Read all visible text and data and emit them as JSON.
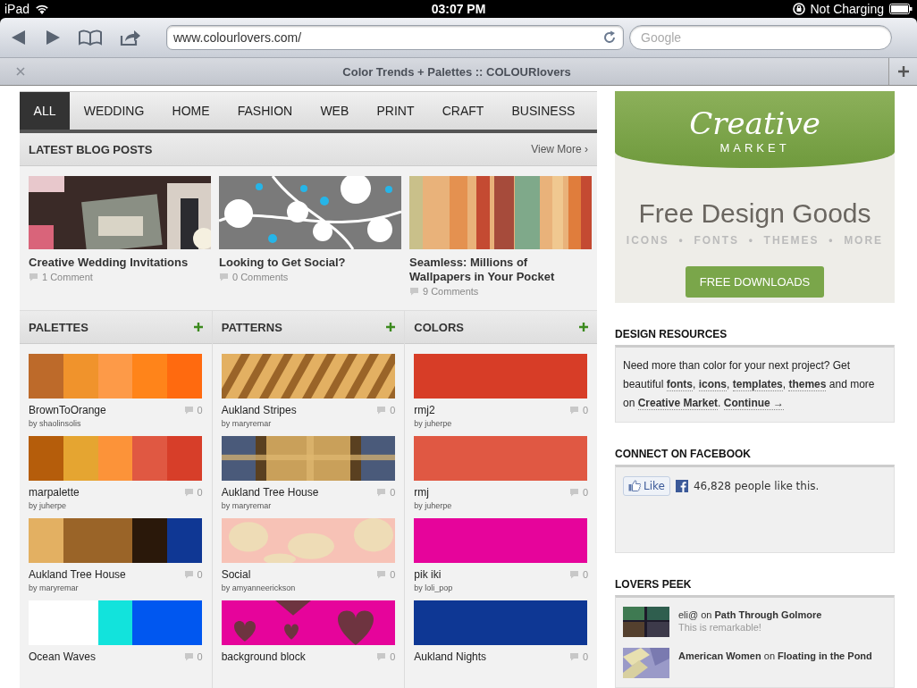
{
  "status_bar": {
    "device": "iPad",
    "time": "03:07 PM",
    "charging": "Not Charging"
  },
  "browser": {
    "url": "www.colourlovers.com/",
    "search_placeholder": "Google",
    "tab_title": "Color Trends + Palettes :: COLOURlovers"
  },
  "nav": [
    {
      "label": "ALL",
      "selected": true
    },
    {
      "label": "WEDDING",
      "selected": false
    },
    {
      "label": "HOME",
      "selected": false
    },
    {
      "label": "FASHION",
      "selected": false
    },
    {
      "label": "WEB",
      "selected": false
    },
    {
      "label": "PRINT",
      "selected": false
    },
    {
      "label": "CRAFT",
      "selected": false
    },
    {
      "label": "BUSINESS",
      "selected": false
    }
  ],
  "blog": {
    "title": "LATEST BLOG POSTS",
    "more": "View More ›",
    "posts": [
      {
        "title": "Creative Wedding Invitations",
        "comments": "1 Comment"
      },
      {
        "title": "Looking to Get Social?",
        "comments": "0 Comments"
      },
      {
        "title": "Seamless: Millions of Wallpapers in Your Pocket",
        "comments": "9 Comments"
      }
    ]
  },
  "sections": [
    {
      "title": "PALETTES",
      "kind": "palettes",
      "items": [
        {
          "name": "BrownToOrange",
          "author": "by shaolinsolis",
          "count": "0",
          "swatches": [
            {
              "color": "#bd6a2a"
            },
            {
              "color": "#f0932c"
            },
            {
              "color": "#fd9a48"
            },
            {
              "color": "#ff841a"
            },
            {
              "color": "#ff6a0f"
            }
          ]
        },
        {
          "name": "marpalette",
          "author": "by juherpe",
          "count": "0",
          "swatches": [
            {
              "color": "#b55d0b"
            },
            {
              "color": "#e5a531"
            },
            {
              "color": "#fc9339"
            },
            {
              "color": "#e05842"
            },
            {
              "color": "#d73e29"
            }
          ]
        },
        {
          "name": "Aukland Tree House",
          "author": "by maryremar",
          "count": "0",
          "swatches": [
            {
              "color": "#e3b062"
            },
            {
              "color": "#9a6428"
            },
            {
              "color": "#9a6428"
            },
            {
              "color": "#2a180a"
            },
            {
              "color": "#0f3794"
            }
          ]
        },
        {
          "name": "Ocean Waves",
          "count": "0",
          "swatches": [
            {
              "color": "#ffffff"
            },
            {
              "color": "#ffffff"
            },
            {
              "color": "#12e3dc"
            },
            {
              "color": "#0057f0"
            },
            {
              "color": "#0057f0"
            }
          ]
        }
      ]
    },
    {
      "title": "PATTERNS",
      "kind": "patterns",
      "items": [
        {
          "name": "Aukland Stripes",
          "author": "by maryremar",
          "count": "0",
          "kind": "stripes"
        },
        {
          "name": "Aukland Tree House",
          "author": "by maryremar",
          "count": "0",
          "kind": "plaid"
        },
        {
          "name": "Social",
          "author": "by amyanneerickson",
          "count": "0",
          "kind": "paisley"
        },
        {
          "name": "background block",
          "count": "0",
          "kind": "hearts"
        }
      ]
    },
    {
      "title": "COLORS",
      "kind": "colors",
      "items": [
        {
          "name": "rmj2",
          "author": "by juherpe",
          "count": "0",
          "color": "#d73d27"
        },
        {
          "name": "rmj",
          "author": "by juherpe",
          "count": "0",
          "color": "#e05843"
        },
        {
          "name": "pik iki",
          "author": "by loli_pop",
          "count": "0",
          "color": "#e6049b"
        },
        {
          "name": "Aukland Nights",
          "count": "0",
          "color": "#0e3794"
        }
      ]
    }
  ],
  "ad": {
    "logo": "Creative",
    "logo_sub": "MARKET",
    "headline": "Free Design Goods",
    "tags": "ICONS  •  FONTS  •  THEMES  •  MORE",
    "button": "FREE DOWNLOADS"
  },
  "design_resources": {
    "title": "DESIGN RESOURCES",
    "segments": [
      {
        "kind": "text",
        "text": "Need more than color for your next project? Get beautiful "
      },
      {
        "kind": "link",
        "text": "fonts"
      },
      {
        "kind": "text",
        "text": ", "
      },
      {
        "kind": "link",
        "text": "icons"
      },
      {
        "kind": "text",
        "text": ", "
      },
      {
        "kind": "link",
        "text": "templates"
      },
      {
        "kind": "text",
        "text": ", "
      },
      {
        "kind": "link",
        "text": "themes"
      },
      {
        "kind": "text",
        "text": " and more on "
      },
      {
        "kind": "link",
        "text": "Creative Market"
      },
      {
        "kind": "text",
        "text": ". "
      },
      {
        "kind": "link",
        "text": "Continue →"
      }
    ]
  },
  "facebook": {
    "title": "CONNECT ON FACEBOOK",
    "like": "Like",
    "count": "46,828 people like this."
  },
  "lovers_peek": {
    "title": "LOVERS PEEK",
    "items": [
      {
        "line": "eli@ on **Path Through Golmore**",
        "comment": "This is remarkable!"
      },
      {
        "line": "**American Women** on **Floating in the Pond**"
      }
    ]
  }
}
